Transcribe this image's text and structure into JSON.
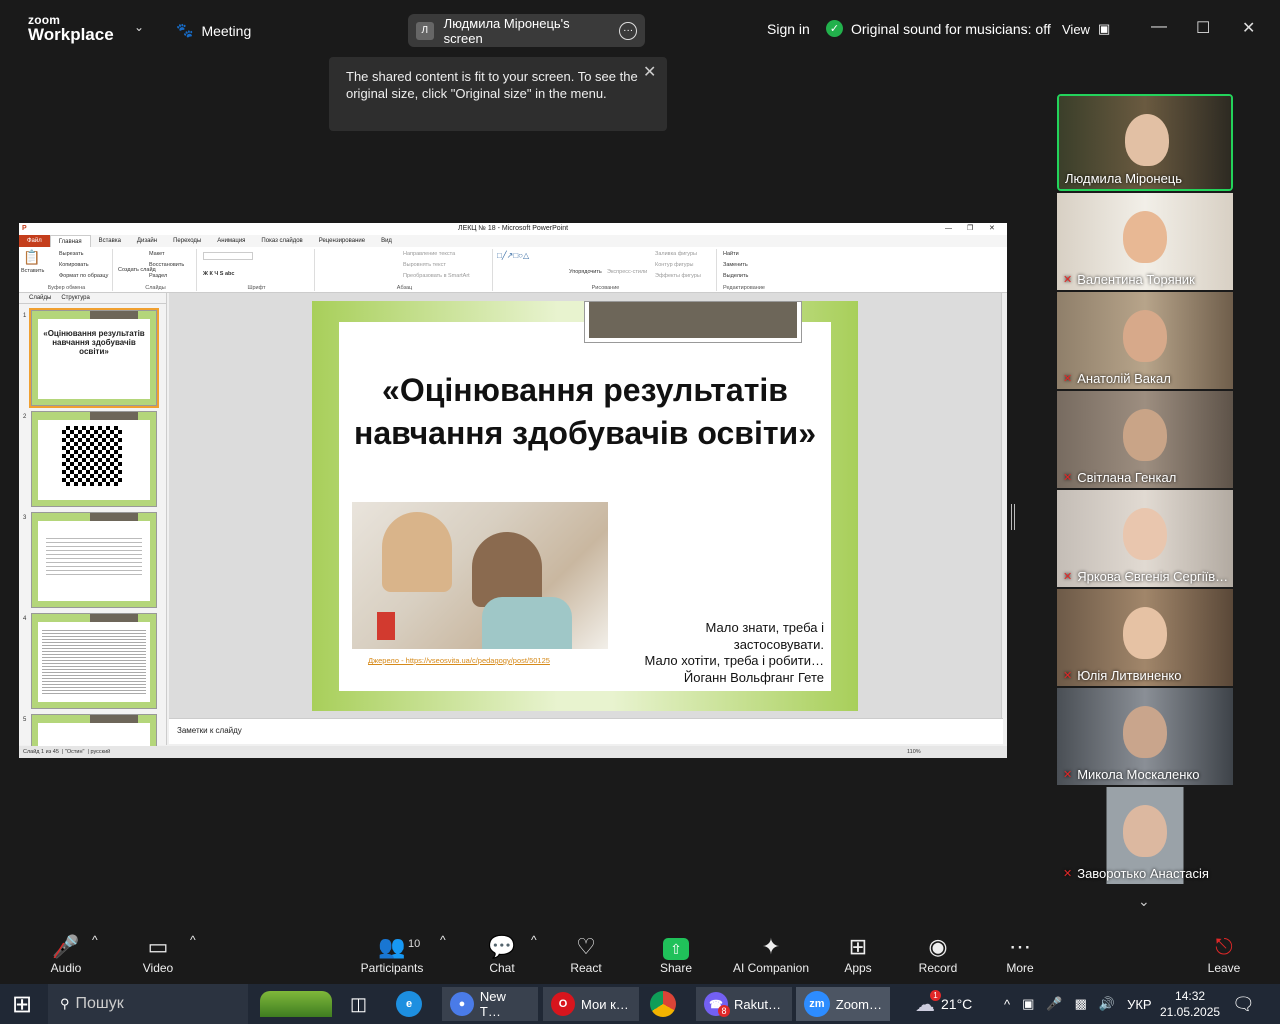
{
  "zoom": {
    "logo_line1": "zoom",
    "logo_line2": "Workplace",
    "meeting_label": "Meeting",
    "screen_initial": "Л",
    "screen_label": "Людмила Міронець's screen",
    "sign_in": "Sign in",
    "sound_label": "Original sound for musicians: off",
    "view_label": "View"
  },
  "tooltip": {
    "text": "The shared content is fit to your screen. To see the original size, click \"Original size\" in the menu."
  },
  "ppt": {
    "window_title": "ЛЕКЦ № 18 - Microsoft PowerPoint",
    "tabs": [
      "Файл",
      "Главная",
      "Вставка",
      "Дизайн",
      "Переходы",
      "Анимация",
      "Показ слайдов",
      "Рецензирование",
      "Вид"
    ],
    "ribbon": {
      "paste": "Вставить",
      "cut": "Вырезать",
      "copy": "Копировать",
      "format_painter": "Формат по образцу",
      "clipboard": "Буфер обмена",
      "new_slide": "Создать слайд",
      "layout": "Макет",
      "reset": "Восстановить",
      "section": "Раздел",
      "slides_group": "Слайды",
      "font_group": "Шрифт",
      "para_group": "Абзац",
      "text_dir": "Направление текста",
      "align_text": "Выровнять текст",
      "smartart": "Преобразовать в SmartArt",
      "arrange": "Упорядочить",
      "quick_styles": "Экспресс-стили",
      "shape_fill": "Заливка фигуры",
      "shape_outline": "Контур фигуры",
      "shape_effects": "Эффекты фигуры",
      "drawing_group": "Рисование",
      "find": "Найти",
      "replace": "Заменить",
      "select": "Выделить",
      "editing_group": "Редактирование"
    },
    "pane_tabs": [
      "Слайды",
      "Структура"
    ],
    "thumb_title": "«Оцінювання результатів навчання здобувачів освіти»",
    "slide": {
      "title": "«Оцінювання результатів навчання здобувачів освіти»",
      "source": "Джерело - https://vseosvita.ua/c/pedagogy/post/50125",
      "quote_l1": "Мало знати, треба і",
      "quote_l2": "застосовувати.",
      "quote_l3": "Мало хотіти, треба і робити…",
      "quote_author": "Йоганн Вольфганг Гете"
    },
    "notes_placeholder": "Заметки к слайду",
    "status": {
      "slide_of": "Слайд 1 из 45",
      "theme": "\"Остин\"",
      "lang": "русский",
      "zoom": "110%"
    }
  },
  "participants": [
    {
      "name": "Людмила Міронець",
      "muted": false,
      "active": true
    },
    {
      "name": "Валентина Торяник",
      "muted": true,
      "active": false
    },
    {
      "name": "Анатолій Вакал",
      "muted": true,
      "active": false
    },
    {
      "name": "Світлана Генкал",
      "muted": true,
      "active": false
    },
    {
      "name": "Яркова Євгенія Сергіїв…",
      "muted": true,
      "active": false
    },
    {
      "name": "Юлія Литвиненко",
      "muted": true,
      "active": false
    },
    {
      "name": "Микола Москаленко",
      "muted": true,
      "active": false
    },
    {
      "name": "Заворотько Анастасія",
      "muted": true,
      "active": false
    }
  ],
  "toolbar": {
    "audio": "Audio",
    "video": "Video",
    "participants": "Participants",
    "participants_count": "10",
    "chat": "Chat",
    "react": "React",
    "share": "Share",
    "ai": "AI Companion",
    "apps": "Apps",
    "record": "Record",
    "more": "More",
    "leave": "Leave"
  },
  "taskbar": {
    "search": "Пошук",
    "app1": "New T…",
    "app2": "Мои к…",
    "app3": "Rakut…",
    "app3_badge": "8",
    "app4": "Zoom…",
    "weather_badge": "1",
    "temp": "21°C",
    "lang": "УКР",
    "time": "14:32",
    "date": "21.05.2025"
  }
}
